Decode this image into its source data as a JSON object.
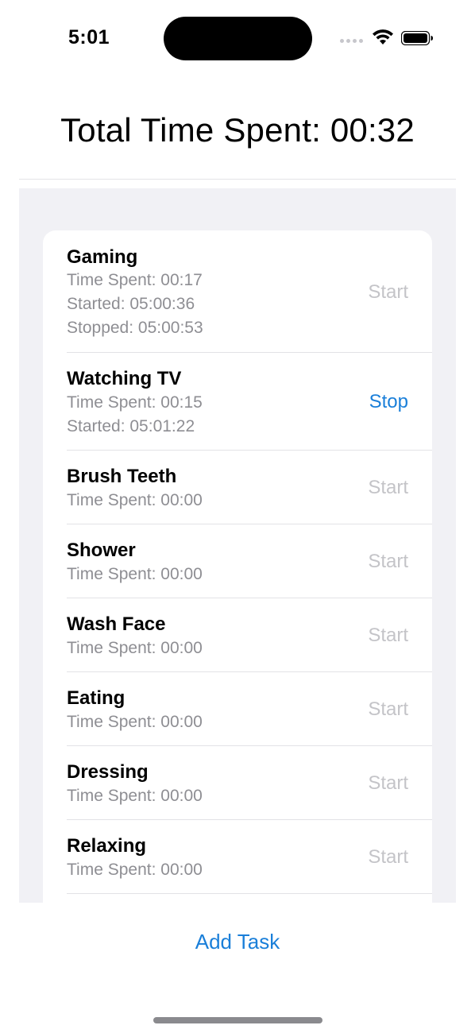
{
  "status_bar": {
    "time": "5:01",
    "signal_icon": "cellular-signal-icon",
    "wifi_icon": "wifi-icon",
    "battery_icon": "battery-icon"
  },
  "header": {
    "total_label": "Total Time Spent: 00:32"
  },
  "tasks": [
    {
      "name": "Gaming",
      "time_spent": "Time Spent: 00:17",
      "started": "Started: 05:00:36",
      "stopped": "Stopped: 05:00:53",
      "action": "Start",
      "running": false
    },
    {
      "name": "Watching TV",
      "time_spent": "Time Spent: 00:15",
      "started": "Started: 05:01:22",
      "action": "Stop",
      "running": true
    },
    {
      "name": "Brush Teeth",
      "time_spent": "Time Spent: 00:00",
      "action": "Start",
      "running": false
    },
    {
      "name": "Shower",
      "time_spent": "Time Spent: 00:00",
      "action": "Start",
      "running": false
    },
    {
      "name": "Wash Face",
      "time_spent": "Time Spent: 00:00",
      "action": "Start",
      "running": false
    },
    {
      "name": "Eating",
      "time_spent": "Time Spent: 00:00",
      "action": "Start",
      "running": false
    },
    {
      "name": "Dressing",
      "time_spent": "Time Spent: 00:00",
      "action": "Start",
      "running": false
    },
    {
      "name": "Relaxing",
      "time_spent": "Time Spent: 00:00",
      "action": "Start",
      "running": false
    }
  ],
  "footer": {
    "add_task_label": "Add Task"
  },
  "colors": {
    "accent": "#1a7fd9",
    "secondary_text": "#8e8e93",
    "disabled_action": "#c4c4c8",
    "grouped_background": "#f1f1f5"
  }
}
